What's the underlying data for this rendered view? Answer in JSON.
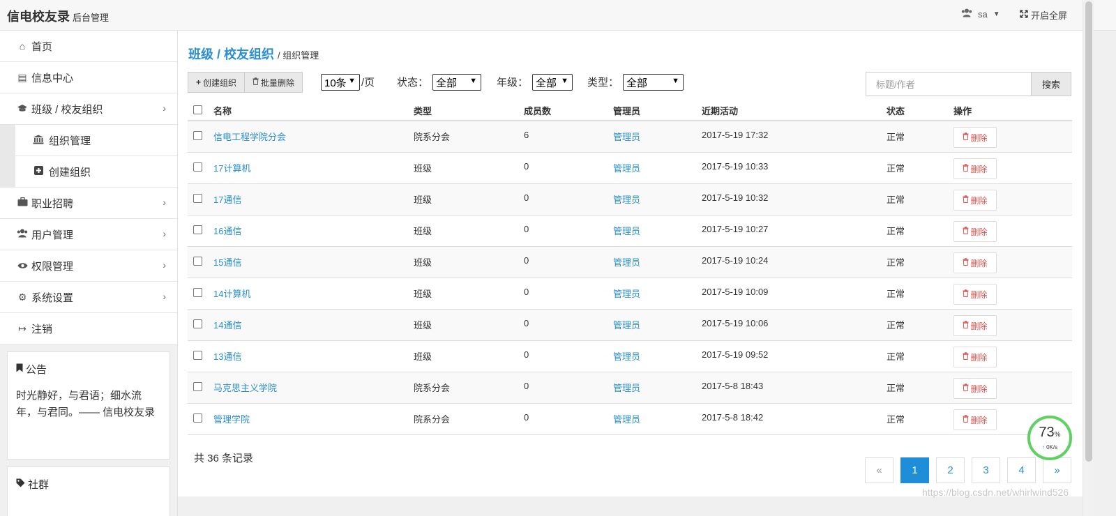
{
  "topbar": {
    "brand": "信电校友录",
    "brand_sub": "后台管理",
    "user": "sa",
    "fullscreen": "开启全屏"
  },
  "sidebar": {
    "items": [
      {
        "label": "首页",
        "icon": "home-icon"
      },
      {
        "label": "信息中心",
        "icon": "newspaper-icon"
      },
      {
        "label": "班级 / 校友组织",
        "icon": "graduation-cap-icon",
        "expanded": true
      },
      {
        "label": "职业招聘",
        "icon": "briefcase-icon"
      },
      {
        "label": "用户管理",
        "icon": "users-icon"
      },
      {
        "label": "权限管理",
        "icon": "eye-icon"
      },
      {
        "label": "系统设置",
        "icon": "gears-icon"
      },
      {
        "label": "注销",
        "icon": "sign-out-icon"
      }
    ],
    "subitems": [
      {
        "label": "组织管理",
        "icon": "bank-icon"
      },
      {
        "label": "创建组织",
        "icon": "plus-square-icon"
      }
    ],
    "notice_title": "公告",
    "notice_body": "时光静好，与君语；细水流年，与君同。—— 信电校友录",
    "community_title": "社群"
  },
  "main": {
    "crumb_main": "班级 / 校友组织",
    "crumb_sub": "/ 组织管理",
    "btn_create": "创建组织",
    "btn_batch_delete": "批量删除",
    "page_size": "10条",
    "per_page": "/页",
    "status_label": "状态：",
    "status_value": "全部",
    "grade_label": "年级：",
    "grade_value": "全部",
    "type_label": "类型：",
    "type_value": "全部",
    "search_placeholder": "标题/作者",
    "search_btn": "搜索",
    "columns": [
      "名称",
      "类型",
      "成员数",
      "管理员",
      "近期活动",
      "状态",
      "操作"
    ],
    "rows": [
      {
        "name": "信电工程学院分会",
        "type": "院系分会",
        "members": "6",
        "admin": "管理员",
        "activity": "2017-5-19 17:32",
        "status": "正常"
      },
      {
        "name": "17计算机",
        "type": "班级",
        "members": "0",
        "admin": "管理员",
        "activity": "2017-5-19 10:33",
        "status": "正常"
      },
      {
        "name": "17通信",
        "type": "班级",
        "members": "0",
        "admin": "管理员",
        "activity": "2017-5-19 10:32",
        "status": "正常"
      },
      {
        "name": "16通信",
        "type": "班级",
        "members": "0",
        "admin": "管理员",
        "activity": "2017-5-19 10:27",
        "status": "正常"
      },
      {
        "name": "15通信",
        "type": "班级",
        "members": "0",
        "admin": "管理员",
        "activity": "2017-5-19 10:24",
        "status": "正常"
      },
      {
        "name": "14计算机",
        "type": "班级",
        "members": "0",
        "admin": "管理员",
        "activity": "2017-5-19 10:09",
        "status": "正常"
      },
      {
        "name": "14通信",
        "type": "班级",
        "members": "0",
        "admin": "管理员",
        "activity": "2017-5-19 10:06",
        "status": "正常"
      },
      {
        "name": "13通信",
        "type": "班级",
        "members": "0",
        "admin": "管理员",
        "activity": "2017-5-19 09:52",
        "status": "正常"
      },
      {
        "name": "马克思主义学院",
        "type": "院系分会",
        "members": "0",
        "admin": "管理员",
        "activity": "2017-5-8 18:43",
        "status": "正常"
      },
      {
        "name": "管理学院",
        "type": "院系分会",
        "members": "0",
        "admin": "管理员",
        "activity": "2017-5-8 18:42",
        "status": "正常"
      }
    ],
    "delete_label": "删除",
    "total_text": "共 36 条记录",
    "pages": [
      "«",
      "1",
      "2",
      "3",
      "4",
      "»"
    ],
    "active_page": "1"
  },
  "gauge": {
    "percent": "73",
    "percent_unit": "%",
    "speed": "0K/s"
  },
  "watermark": "https://blog.csdn.net/whirlwind526",
  "colors": {
    "accent": "#2a8fd4",
    "danger": "#d9534f",
    "active_page": "#1e8ed8",
    "gauge": "#5fd061"
  }
}
